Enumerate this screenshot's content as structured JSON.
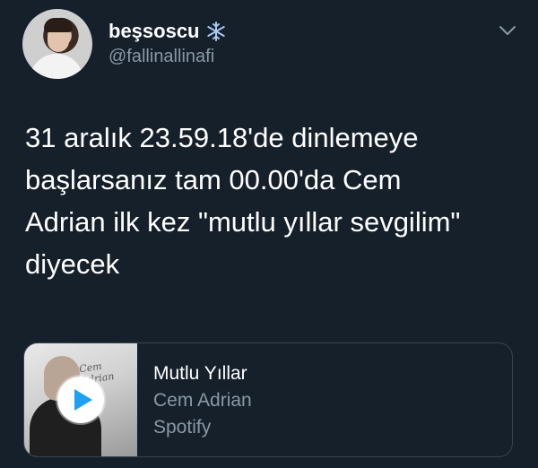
{
  "user": {
    "display_name": "beşsoscu",
    "handle": "@fallinallinafi",
    "badge_icon": "snowflake-icon"
  },
  "tweet": {
    "text": "31 aralık 23.59.18'de dinlemeye\nbaşlarsanız tam 00.00'da Cem\nAdrian ilk kez \"mutlu yıllar sevgilim\"\ndiyecek"
  },
  "card": {
    "title": "Mutlu Yıllar",
    "artist": "Cem Adrian",
    "source": "Spotify",
    "art_script": "Cem Adrian"
  },
  "colors": {
    "background": "#15202b",
    "accent": "#1da1f2",
    "secondary_text": "#8899a6",
    "border": "#38444d"
  }
}
